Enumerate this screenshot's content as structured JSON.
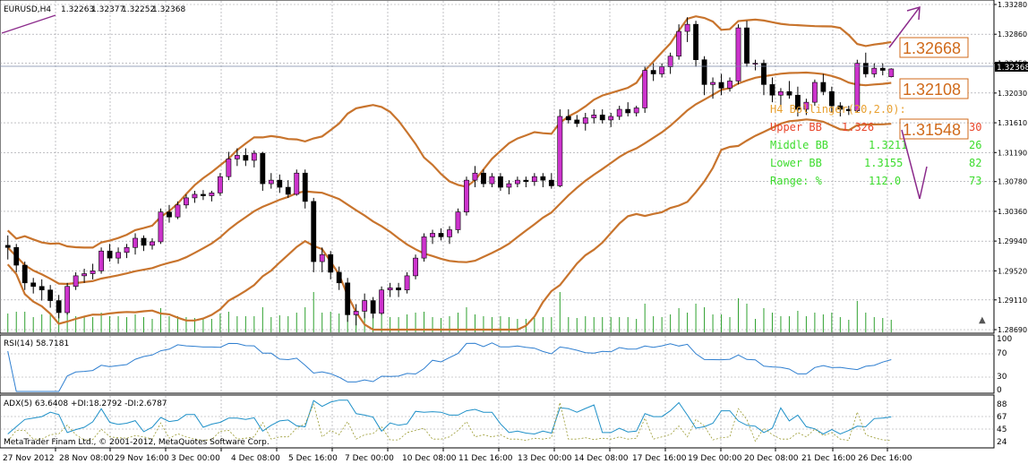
{
  "main_window": {
    "symbol_label": "EURUSD,H4",
    "ohlc": [
      "1.32263",
      "1.32377",
      "1.32252",
      "1.32368"
    ],
    "price_ticks": [
      "1.33280",
      "1.32860",
      "1.32450",
      "1.32030",
      "1.31610",
      "1.31190",
      "1.30780",
      "1.30360",
      "1.29940",
      "1.29520",
      "1.29110",
      "1.28690"
    ],
    "current_price": "1.32368",
    "upper_band_callout": "1.32668",
    "middle_band_callout": "1.32108",
    "lower_band_callout": "1.31548"
  },
  "bollinger_panel": {
    "title": "H4 Bollinger(20,2.0):",
    "rows": [
      {
        "name": "Upper BB",
        "value": "1.326",
        "extra": "30",
        "color": "#e8452a"
      },
      {
        "name": "Middle BB",
        "value": "1.3211",
        "extra": "26",
        "color": "#3ddc2e"
      },
      {
        "name": "Lower BB",
        "value": "1.3155",
        "extra": "82",
        "color": "#3ddc2e"
      },
      {
        "name": "Range: %",
        "value": "112.0",
        "extra": "73",
        "color": "#3ddc2e"
      }
    ]
  },
  "rsi_window": {
    "label": "RSI(14) 58.7181",
    "ticks": [
      "100",
      "70",
      "30",
      "0"
    ]
  },
  "adx_window": {
    "label": "ADX(5) 63.6408 +DI:18.2792 -DI:2.6787",
    "ticks": [
      "88",
      "67",
      "45",
      "24",
      "02"
    ]
  },
  "copyright": "MetaTrader Finam Ltd., © 2001-2012, MetaQuotes Software Corp.",
  "time_axis": [
    "27 Nov 2012",
    "28 Nov 08:00",
    "29 Nov 16:00",
    "3 Dec 00:00",
    "4 Dec 08:00",
    "5 Dec 16:00",
    "7 Dec 00:00",
    "10 Dec 08:00",
    "11 Dec 16:00",
    "13 Dec 00:00",
    "14 Dec 08:00",
    "17 Dec 16:00",
    "19 Dec 00:00",
    "20 Dec 08:00",
    "21 Dec 16:00",
    "26 Dec 16:00"
  ],
  "colors": {
    "bull_candle": "#cc33cc",
    "bear_candle": "#000000",
    "band_line": "#c8742d",
    "volume": "#2ea02e",
    "rsi_line": "#2f7fd0",
    "adx_line": "#1e90c8",
    "callout_text": "#d06a1a",
    "arrow": "#8b2a8b",
    "grid": "#9a9aa0"
  },
  "chart_data": {
    "type": "candlestick",
    "symbol": "EURUSD",
    "timeframe": "H4",
    "ylim": [
      1.2869,
      1.3328
    ],
    "candles": [
      [
        1.2988,
        1.3002,
        1.2968,
        1.2985
      ],
      [
        1.2985,
        1.299,
        1.295,
        1.296
      ],
      [
        1.296,
        1.2965,
        1.2925,
        1.2935
      ],
      [
        1.2935,
        1.2942,
        1.292,
        1.293
      ],
      [
        1.293,
        1.294,
        1.291,
        1.2925
      ],
      [
        1.2925,
        1.2932,
        1.29,
        1.291
      ],
      [
        1.291,
        1.2918,
        1.2885,
        1.2893
      ],
      [
        1.2893,
        1.2935,
        1.289,
        1.293
      ],
      [
        1.293,
        1.295,
        1.2925,
        1.2945
      ],
      [
        1.2945,
        1.2955,
        1.2935,
        1.2948
      ],
      [
        1.2948,
        1.2962,
        1.294,
        1.2952
      ],
      [
        1.2952,
        1.2985,
        1.2948,
        1.298
      ],
      [
        1.298,
        1.299,
        1.2965,
        1.297
      ],
      [
        1.297,
        1.2985,
        1.2962,
        1.2978
      ],
      [
        1.2978,
        1.299,
        1.297,
        1.2985
      ],
      [
        1.2985,
        1.3005,
        1.2975,
        1.2998
      ],
      [
        1.2998,
        1.3002,
        1.298,
        1.2988
      ],
      [
        1.2988,
        1.2998,
        1.2982,
        1.2993
      ],
      [
        1.2993,
        1.304,
        1.299,
        1.3035
      ],
      [
        1.3035,
        1.3045,
        1.302,
        1.3028
      ],
      [
        1.3028,
        1.305,
        1.3025,
        1.3045
      ],
      [
        1.3045,
        1.306,
        1.304,
        1.3055
      ],
      [
        1.3055,
        1.3065,
        1.3048,
        1.306
      ],
      [
        1.306,
        1.3066,
        1.3052,
        1.3058
      ],
      [
        1.3058,
        1.3065,
        1.305,
        1.3062
      ],
      [
        1.3062,
        1.309,
        1.3058,
        1.3085
      ],
      [
        1.3085,
        1.312,
        1.308,
        1.311
      ],
      [
        1.311,
        1.3125,
        1.31,
        1.3115
      ],
      [
        1.3115,
        1.3125,
        1.31,
        1.3108
      ],
      [
        1.3108,
        1.3122,
        1.3098,
        1.3118
      ],
      [
        1.3118,
        1.312,
        1.3065,
        1.3075
      ],
      [
        1.3075,
        1.309,
        1.3068,
        1.308
      ],
      [
        1.308,
        1.3088,
        1.3062,
        1.307
      ],
      [
        1.307,
        1.308,
        1.3055,
        1.306
      ],
      [
        1.306,
        1.3095,
        1.3058,
        1.309
      ],
      [
        1.309,
        1.3095,
        1.304,
        1.305
      ],
      [
        1.305,
        1.3055,
        1.295,
        1.2965
      ],
      [
        1.2965,
        1.2985,
        1.295,
        1.2975
      ],
      [
        1.2975,
        1.298,
        1.294,
        1.295
      ],
      [
        1.295,
        1.2958,
        1.2925,
        1.2935
      ],
      [
        1.2935,
        1.2942,
        1.288,
        1.289
      ],
      [
        1.289,
        1.2905,
        1.2875,
        1.2895
      ],
      [
        1.2895,
        1.292,
        1.2885,
        1.291
      ],
      [
        1.291,
        1.2915,
        1.2885,
        1.2892
      ],
      [
        1.2892,
        1.293,
        1.289,
        1.2925
      ],
      [
        1.2925,
        1.2935,
        1.2915,
        1.2928
      ],
      [
        1.2928,
        1.2935,
        1.2915,
        1.2925
      ],
      [
        1.2925,
        1.295,
        1.292,
        1.2945
      ],
      [
        1.2945,
        1.2975,
        1.294,
        1.297
      ],
      [
        1.297,
        1.3005,
        1.2965,
        1.3
      ],
      [
        1.3,
        1.301,
        1.299,
        1.3005
      ],
      [
        1.3005,
        1.3012,
        1.2995,
        1.3
      ],
      [
        1.3,
        1.3015,
        1.299,
        1.301
      ],
      [
        1.301,
        1.304,
        1.3005,
        1.3035
      ],
      [
        1.3035,
        1.3085,
        1.303,
        1.308
      ],
      [
        1.308,
        1.31,
        1.307,
        1.309
      ],
      [
        1.309,
        1.3095,
        1.307,
        1.3075
      ],
      [
        1.3075,
        1.309,
        1.307,
        1.3085
      ],
      [
        1.3085,
        1.309,
        1.3065,
        1.307
      ],
      [
        1.307,
        1.308,
        1.306,
        1.3075
      ],
      [
        1.3075,
        1.3085,
        1.307,
        1.308
      ],
      [
        1.308,
        1.3085,
        1.307,
        1.3078
      ],
      [
        1.3078,
        1.309,
        1.3072,
        1.3085
      ],
      [
        1.3085,
        1.309,
        1.307,
        1.308
      ],
      [
        1.308,
        1.309,
        1.3068,
        1.3072
      ],
      [
        1.3072,
        1.318,
        1.307,
        1.317
      ],
      [
        1.317,
        1.318,
        1.316,
        1.3165
      ],
      [
        1.3165,
        1.3172,
        1.3155,
        1.316
      ],
      [
        1.316,
        1.3175,
        1.315,
        1.3168
      ],
      [
        1.3168,
        1.318,
        1.316,
        1.3172
      ],
      [
        1.3172,
        1.318,
        1.316,
        1.3165
      ],
      [
        1.3165,
        1.3175,
        1.3155,
        1.317
      ],
      [
        1.317,
        1.3185,
        1.3165,
        1.318
      ],
      [
        1.318,
        1.319,
        1.317,
        1.3175
      ],
      [
        1.3175,
        1.3185,
        1.317,
        1.3182
      ],
      [
        1.3182,
        1.324,
        1.3175,
        1.3235
      ],
      [
        1.3235,
        1.3245,
        1.322,
        1.323
      ],
      [
        1.323,
        1.3245,
        1.3225,
        1.324
      ],
      [
        1.324,
        1.326,
        1.323,
        1.3255
      ],
      [
        1.3255,
        1.33,
        1.325,
        1.329
      ],
      [
        1.329,
        1.331,
        1.3275,
        1.33
      ],
      [
        1.33,
        1.3305,
        1.324,
        1.325
      ],
      [
        1.325,
        1.3255,
        1.32,
        1.3215
      ],
      [
        1.3215,
        1.3225,
        1.3195,
        1.3218
      ],
      [
        1.3218,
        1.323,
        1.32,
        1.321
      ],
      [
        1.321,
        1.3225,
        1.3205,
        1.322
      ],
      [
        1.322,
        1.33,
        1.3215,
        1.3295
      ],
      [
        1.3295,
        1.3305,
        1.324,
        1.3245
      ],
      [
        1.3245,
        1.325,
        1.3235,
        1.3245
      ],
      [
        1.3245,
        1.325,
        1.32,
        1.3215
      ],
      [
        1.3215,
        1.3225,
        1.319,
        1.32
      ],
      [
        1.32,
        1.321,
        1.3185,
        1.3205
      ],
      [
        1.3205,
        1.322,
        1.3195,
        1.32
      ],
      [
        1.32,
        1.3212,
        1.317,
        1.318
      ],
      [
        1.318,
        1.3195,
        1.3172,
        1.319
      ],
      [
        1.319,
        1.3222,
        1.3185,
        1.3218
      ],
      [
        1.3218,
        1.323,
        1.32,
        1.3205
      ],
      [
        1.3205,
        1.3212,
        1.3175,
        1.3185
      ],
      [
        1.3185,
        1.319,
        1.317,
        1.318
      ],
      [
        1.318,
        1.3185,
        1.3172,
        1.3178
      ],
      [
        1.3178,
        1.325,
        1.3175,
        1.3245
      ],
      [
        1.3245,
        1.326,
        1.3225,
        1.323
      ],
      [
        1.323,
        1.3245,
        1.3225,
        1.3238
      ],
      [
        1.3238,
        1.3245,
        1.3228,
        1.3235
      ],
      [
        1.3226,
        1.3238,
        1.3225,
        1.3237
      ]
    ],
    "bollinger": {
      "period": 20,
      "deviation": 2.0,
      "upper_callout": 1.32668,
      "middle_callout": 1.32108,
      "lower_callout": 1.31548
    },
    "indicators": {
      "rsi_period": 14,
      "rsi_value": 58.7181,
      "adx_period": 5,
      "adx_value": 63.6408,
      "plus_di": 18.2792,
      "minus_di": 2.6787
    }
  }
}
